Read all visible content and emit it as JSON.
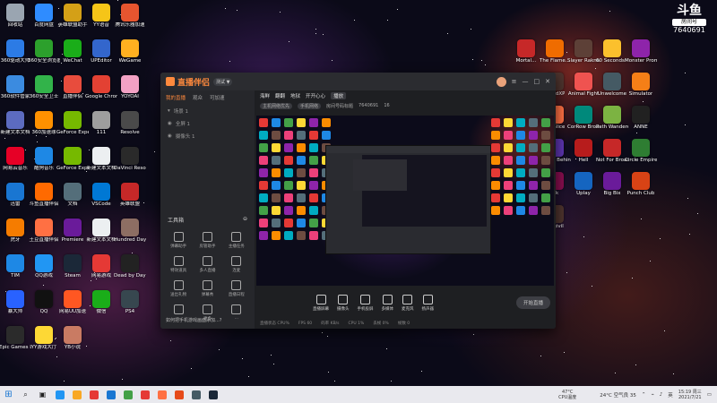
{
  "stream_overlay": {
    "logo_text": "斗鱼",
    "room_label": "房间号",
    "room_number": "7640691"
  },
  "desktop": {
    "left_icons": [
      {
        "label": "回收站",
        "color": "#9aa5b1"
      },
      {
        "label": "百度网盘",
        "color": "#2f8cff"
      },
      {
        "label": "英雄联盟助手",
        "color": "#d4a017"
      },
      {
        "label": "YY语音",
        "color": "#f5c518"
      },
      {
        "label": "腾讯乐器加速",
        "color": "#e6552f"
      },
      {
        "label": "360驱动大师",
        "color": "#2c7be5"
      },
      {
        "label": "360安全浏览器",
        "color": "#2ca02c"
      },
      {
        "label": "WeChat",
        "color": "#1aad19"
      },
      {
        "label": "UPEditor",
        "color": "#3366cc"
      },
      {
        "label": "WeGame",
        "color": "#ffb020"
      },
      {
        "label": "360软件管家",
        "color": "#3b8be0"
      },
      {
        "label": "360安全卫士",
        "color": "#32b34a"
      },
      {
        "label": "直播伴侣",
        "color": "#e84c3d"
      },
      {
        "label": "Google Chrome",
        "color": "#e34133"
      },
      {
        "label": "YOYOAI",
        "color": "#f2a1c4"
      },
      {
        "label": "新建文本文档",
        "color": "#5c6bc0"
      },
      {
        "label": "360加速球",
        "color": "#ff9100"
      },
      {
        "label": "GeForce Experience",
        "color": "#76b900"
      },
      {
        "label": "111",
        "color": "#9e9e9e"
      },
      {
        "label": "Resolve",
        "color": "#4a4a4a"
      },
      {
        "label": "网易云音乐",
        "color": "#e60026"
      },
      {
        "label": "酷狗音乐",
        "color": "#1e88e5"
      },
      {
        "label": "GeForce Experience",
        "color": "#76b900"
      },
      {
        "label": "新建文本文档",
        "color": "#eceff1"
      },
      {
        "label": "DaVinci Resolve",
        "color": "#2a2a2a"
      },
      {
        "label": "迅雷",
        "color": "#1976d2"
      },
      {
        "label": "斗鱼直播伴侣",
        "color": "#ff6a00"
      },
      {
        "label": "文档",
        "color": "#546e7a"
      },
      {
        "label": "VSCode",
        "color": "#0078d4"
      },
      {
        "label": "英雄联盟",
        "color": "#c62828"
      },
      {
        "label": "虎牙",
        "color": "#f57c00"
      },
      {
        "label": "土豆直播伴侣",
        "color": "#ff7043"
      },
      {
        "label": "Premiere",
        "color": "#6a1b9a"
      },
      {
        "label": "新建文本文档",
        "color": "#eceff1"
      },
      {
        "label": "Hundred Days",
        "color": "#8d6e63"
      },
      {
        "label": "TIM",
        "color": "#1e88e5"
      },
      {
        "label": "QQ游戏",
        "color": "#2196f3"
      },
      {
        "label": "Steam",
        "color": "#1b2838"
      },
      {
        "label": "网易游戏",
        "color": "#e53935"
      },
      {
        "label": "Dead by Daylight",
        "color": "#222222"
      },
      {
        "label": "暴大师",
        "color": "#2962ff"
      },
      {
        "label": "QQ",
        "color": "#111111"
      },
      {
        "label": "网易UU加速",
        "color": "#ff5722"
      },
      {
        "label": "微信",
        "color": "#1aad19"
      },
      {
        "label": "PS4",
        "color": "#37474f"
      },
      {
        "label": "Epic Games Launcher",
        "color": "#2b2b2b"
      },
      {
        "label": "YY游戏大厅",
        "color": "#fdd835"
      },
      {
        "label": "YB小说",
        "color": "#c97b63"
      }
    ],
    "right_icons": [
      {
        "label": "Mortal...",
        "color": "#c62828"
      },
      {
        "label": "The Flame...",
        "color": "#ef6c00"
      },
      {
        "label": "Slayer Raknas",
        "color": "#5d4037"
      },
      {
        "label": "60 Seconds! Reatomized",
        "color": "#fbc02d"
      },
      {
        "label": "Monster Prom",
        "color": "#8e24aa"
      },
      {
        "label": "Ghostrunner",
        "color": "#263238"
      },
      {
        "label": "dreadXP",
        "color": "#4e342e"
      },
      {
        "label": "Animal Fight",
        "color": "#ef5350"
      },
      {
        "label": "Unwelcome",
        "color": "#455a64"
      },
      {
        "label": "Simulator",
        "color": "#f57f17"
      },
      {
        "label": "CHANGE A Homeless...",
        "color": "#6d4c41"
      },
      {
        "label": "My Slice",
        "color": "#ff7043"
      },
      {
        "label": "CorRow Broadcast",
        "color": "#00897b"
      },
      {
        "label": "Path Wanderer",
        "color": "#7cb342"
      },
      {
        "label": "ANNE",
        "color": "#212121"
      },
      {
        "label": "BIOSHOCK",
        "color": "#37474f"
      },
      {
        "label": "Hollow Behind",
        "color": "#5e35b1"
      },
      {
        "label": "Hell",
        "color": "#b71c1c"
      },
      {
        "label": "Not For Broadcast",
        "color": "#c62828"
      },
      {
        "label": "Circle Empire",
        "color": "#2e7d32"
      },
      {
        "label": "FTL Faster Than Light",
        "color": "#424242"
      },
      {
        "label": "Ink",
        "color": "#880e4f"
      },
      {
        "label": "Uplay",
        "color": "#1565c0"
      },
      {
        "label": "Big Bix",
        "color": "#6a1b9a"
      },
      {
        "label": "Punch Club",
        "color": "#d84315"
      },
      {
        "label": "十月哈普计划",
        "color": "#ad1457"
      },
      {
        "label": "Turgivil",
        "color": "#4e342e"
      }
    ]
  },
  "app_window": {
    "app_name": "直播伴侣",
    "version_badge": "测试 ▼",
    "tabs": [
      "我的直播",
      "观众",
      "可加速"
    ],
    "scene_label": "场景 1",
    "source_label": "全屏 1",
    "source2_label": "摄像头 1",
    "top_info": [
      "海鲜",
      "翻翻",
      "地狱",
      "开开心心",
      "播放"
    ],
    "top_info_sub": [
      "主机网络优先",
      "手机网络",
      "房间号码标题",
      "7640691",
      "16"
    ],
    "tools_title": "工具箱",
    "tools": [
      "弹幕助手",
      "房管助手",
      "主播任务",
      "特效道具",
      "多人直播",
      "连麦",
      "送出礼物",
      "弹幕秀",
      "直播日程",
      "...",
      "更多",
      "..."
    ],
    "bottom_note": "如何把手机游戏画面添加...?",
    "controls": [
      "直播屏幕",
      "摄像头",
      "手机投屏",
      "多媒体",
      "麦克风",
      "扬声器"
    ],
    "start_button": "开始直播",
    "status": [
      "直播状态 CPU%",
      "FPS 60",
      "码率 KB/s",
      "CPU 1%",
      "丢帧 0%",
      "帧数 0"
    ]
  },
  "taskbar": {
    "search_label": "",
    "pinned": [
      {
        "name": "search-icon",
        "glyph": "⌕"
      },
      {
        "name": "task-view-icon",
        "glyph": "▣"
      },
      {
        "name": "edge-icon",
        "color": "#2196f3"
      },
      {
        "name": "folder-icon",
        "color": "#f9a825"
      },
      {
        "name": "chrome-icon",
        "color": "#e53935"
      },
      {
        "name": "store-icon",
        "color": "#1976d2"
      },
      {
        "name": "media-icon",
        "color": "#43a047"
      },
      {
        "name": "netease-icon",
        "color": "#e53935"
      },
      {
        "name": "app-icon",
        "color": "#ff7043"
      },
      {
        "name": "douyu-icon",
        "color": "#e64a19"
      },
      {
        "name": "tools-icon",
        "color": "#455a64"
      },
      {
        "name": "steam-icon",
        "color": "#1b2838"
      }
    ],
    "cpu_temp": "47°C",
    "cpu_label": "CPU温度",
    "weather": "24°C 空气良 35",
    "ime": "英",
    "time": "15:19 周三",
    "date": "2021/7/21"
  }
}
